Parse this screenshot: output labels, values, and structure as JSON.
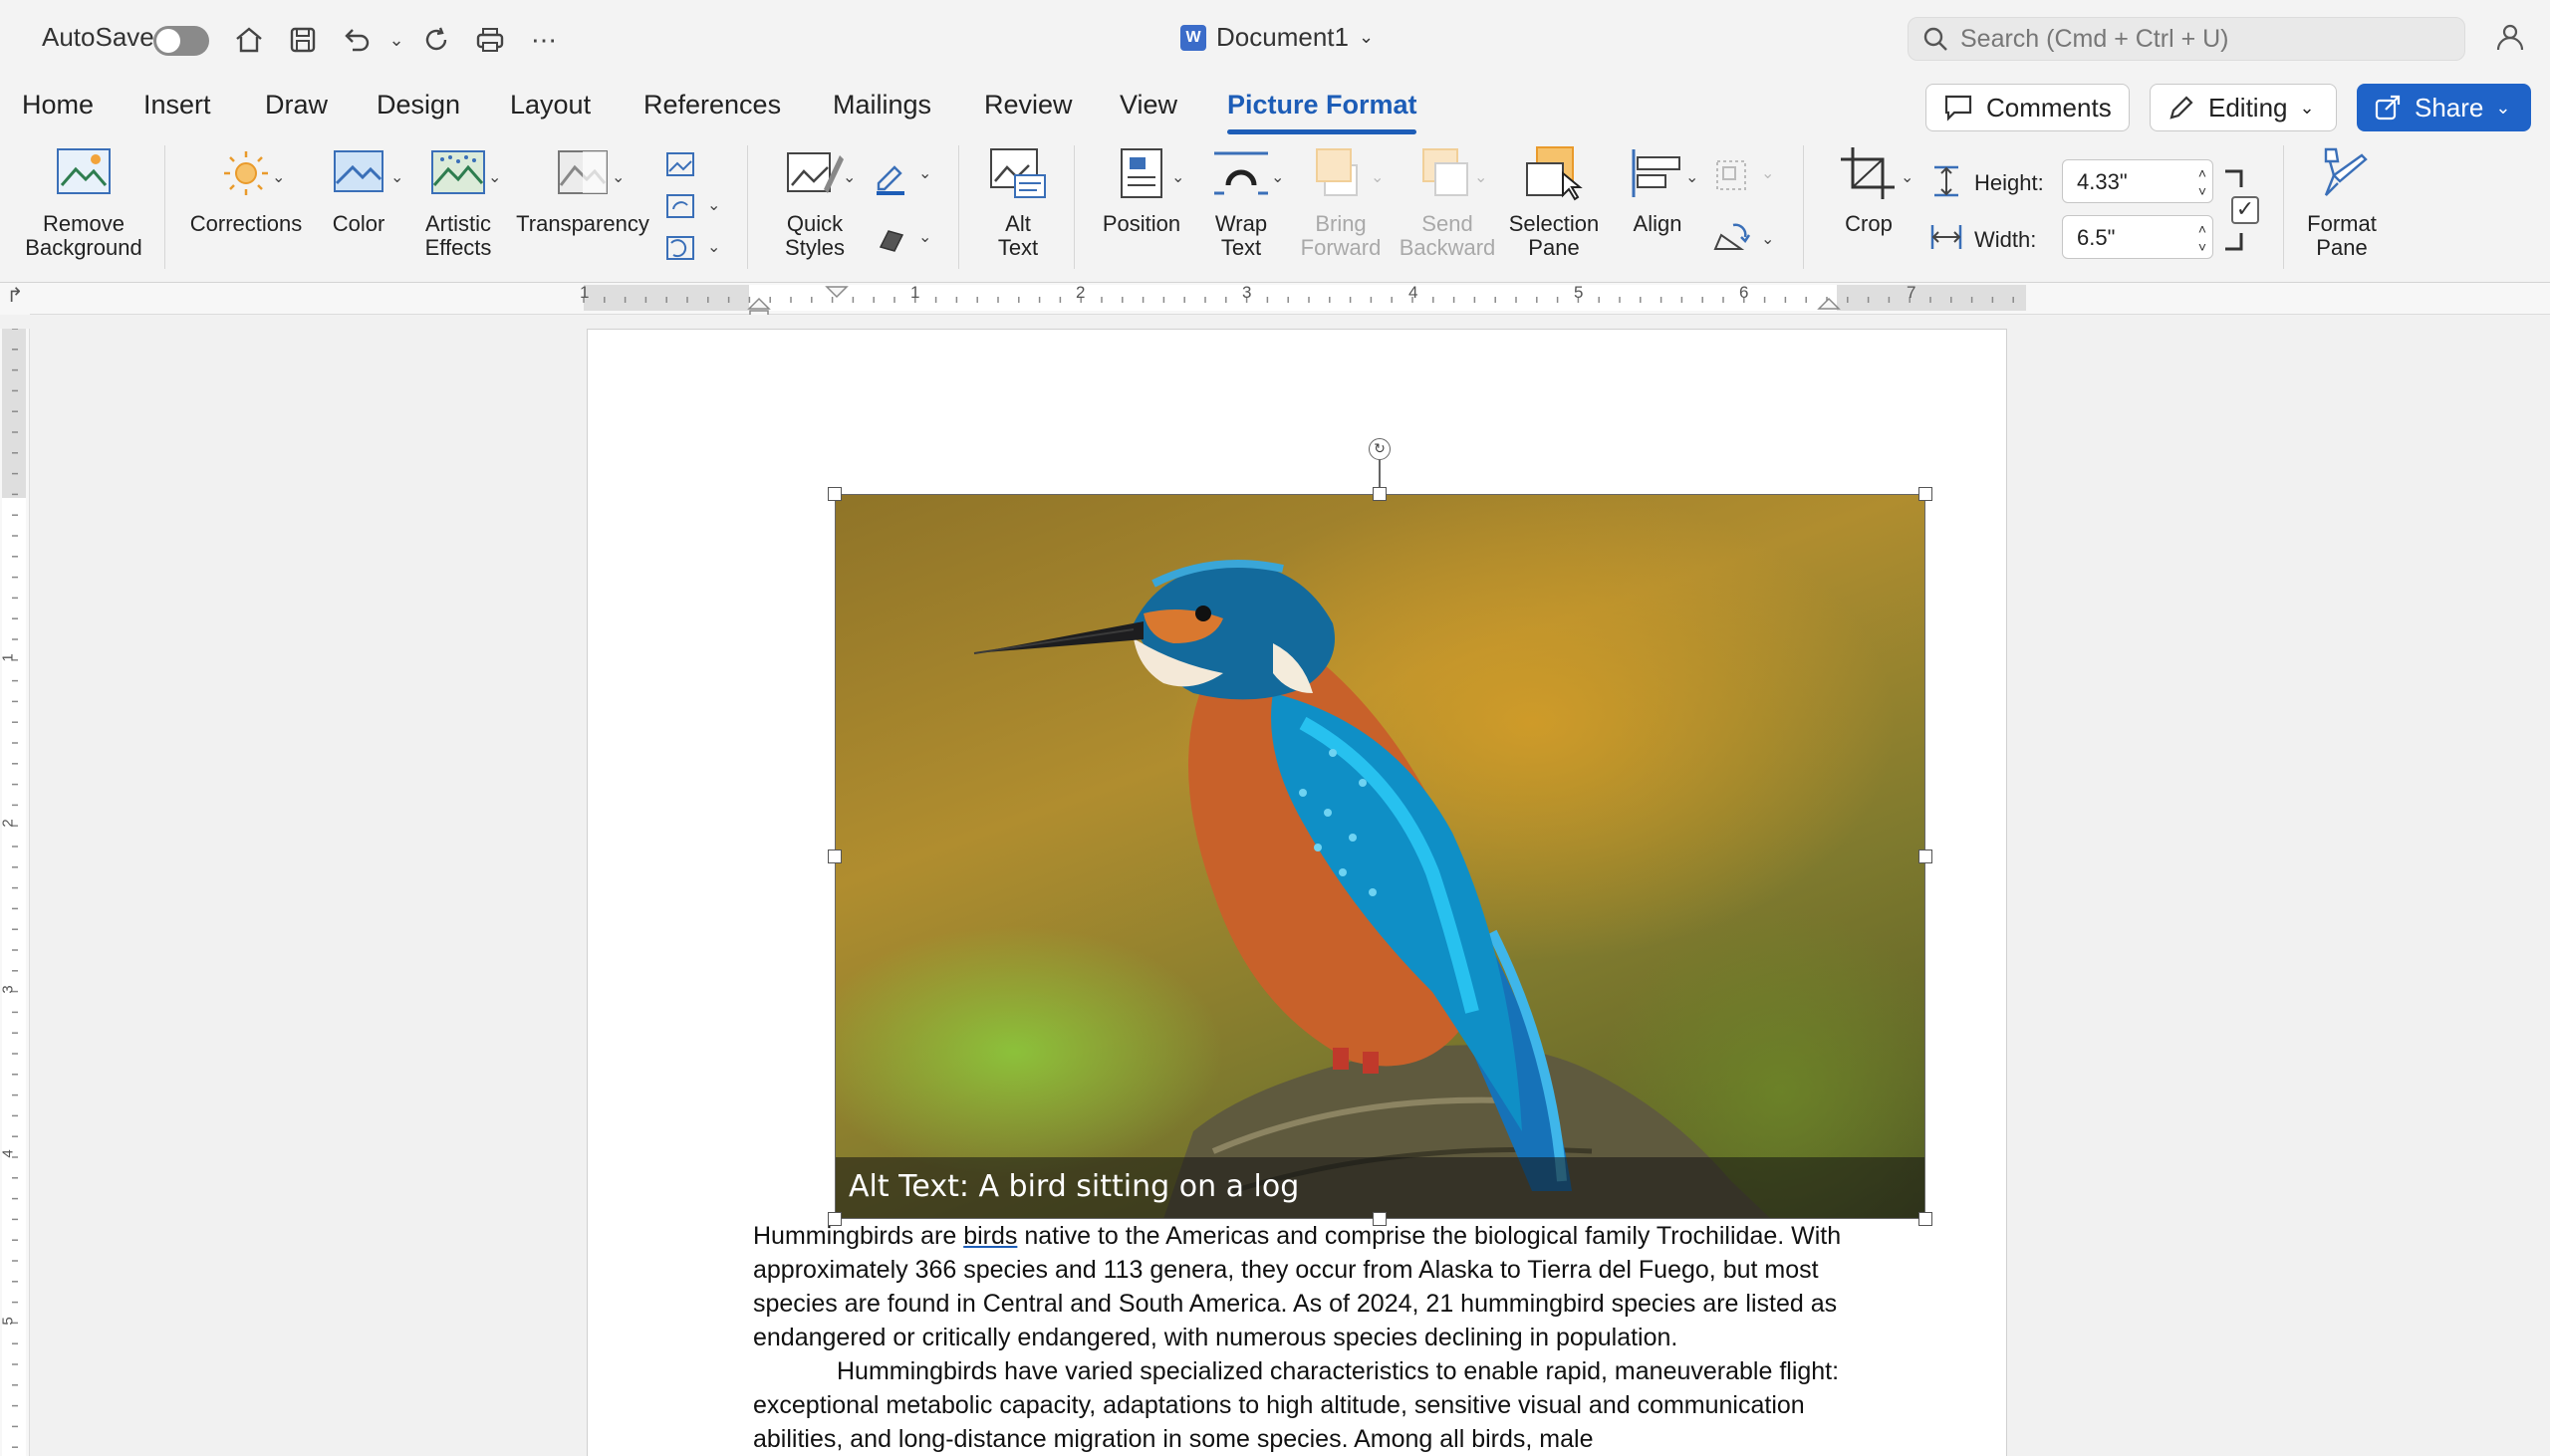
{
  "titlebar": {
    "autosave_label": "AutoSave",
    "document_title": "Document1",
    "search_placeholder": "Search (Cmd + Ctrl + U)"
  },
  "tabs": [
    {
      "label": "Home"
    },
    {
      "label": "Insert"
    },
    {
      "label": "Draw"
    },
    {
      "label": "Design"
    },
    {
      "label": "Layout"
    },
    {
      "label": "References"
    },
    {
      "label": "Mailings"
    },
    {
      "label": "Review"
    },
    {
      "label": "View"
    },
    {
      "label": "Picture Format",
      "active": true
    }
  ],
  "actions": {
    "comments": "Comments",
    "editing": "Editing",
    "share": "Share"
  },
  "ribbon": {
    "remove_background": [
      "Remove",
      "Background"
    ],
    "corrections": "Corrections",
    "color": "Color",
    "artistic_effects": [
      "Artistic",
      "Effects"
    ],
    "transparency": "Transparency",
    "quick_styles": [
      "Quick",
      "Styles"
    ],
    "alt_text": [
      "Alt",
      "Text"
    ],
    "position": "Position",
    "wrap_text": [
      "Wrap",
      "Text"
    ],
    "bring_forward": [
      "Bring",
      "Forward"
    ],
    "send_backward": [
      "Send",
      "Backward"
    ],
    "selection_pane": [
      "Selection",
      "Pane"
    ],
    "align": "Align",
    "crop": "Crop",
    "height_label": "Height:",
    "height_value": "4.33\"",
    "width_label": "Width:",
    "width_value": "6.5\"",
    "format_pane": [
      "Format",
      "Pane"
    ]
  },
  "ruler": {
    "labels": [
      "1",
      "1",
      "2",
      "3",
      "4",
      "5",
      "6",
      "7"
    ],
    "vlabels": [
      "1",
      "2",
      "3",
      "4",
      "5"
    ]
  },
  "document": {
    "alt_text_caption": "Alt Text: A bird sitting on a log",
    "paragraph1_pre": "Hummingbirds are ",
    "paragraph1_link": "birds",
    "paragraph1_post": " native to the Americas and comprise the biological family Trochilidae. With approximately 366 species and 113 genera, they occur from Alaska to Tierra del Fuego, but most species are found in Central and South America. As of 2024, 21 hummingbird species are listed as endangered or critically endangered, with numerous species declining in population.",
    "paragraph2": "Hummingbirds have varied specialized characteristics to enable rapid, maneuverable flight: exceptional metabolic capacity, adaptations to high altitude, sensitive visual and communication abilities, and long-distance migration in some species. Among all birds, male"
  },
  "colors": {
    "accent": "#1d5db7",
    "share_bg": "#1f63c8"
  }
}
